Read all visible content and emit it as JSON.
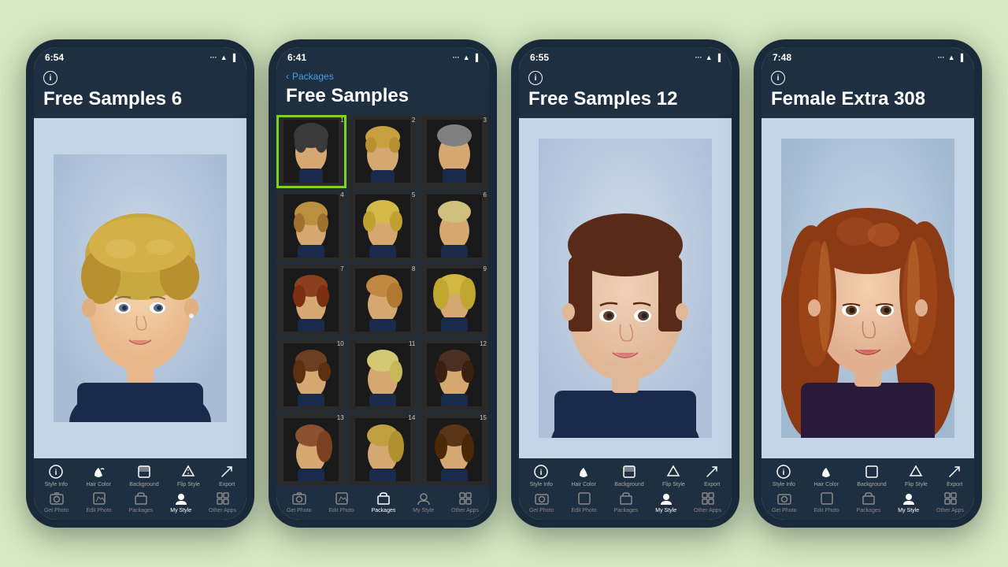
{
  "phones": [
    {
      "id": "phone1",
      "status": {
        "time": "6:54",
        "signal": "···",
        "wifi": "wifi",
        "battery": "battery"
      },
      "header": {
        "show_back": false,
        "back_label": "",
        "back_packages": "",
        "info_icon": "i",
        "title": "Free Samples 6"
      },
      "content_type": "single_photo",
      "toolbar": {
        "top_items": [
          {
            "icon": "ℹ",
            "label": "Style Info"
          },
          {
            "icon": "🪣",
            "label": "Hair Color"
          },
          {
            "icon": "🖼",
            "label": "Background"
          },
          {
            "icon": "⛵",
            "label": "Flip Style"
          },
          {
            "icon": "↗",
            "label": "Export"
          }
        ],
        "bottom_items": [
          {
            "icon": "📷",
            "label": "Get Photo"
          },
          {
            "icon": "✂",
            "label": "Edit Photo"
          },
          {
            "icon": "📦",
            "label": "Packages"
          },
          {
            "icon": "👤",
            "label": "My Style",
            "active": true
          },
          {
            "icon": "⬛",
            "label": "Other Apps"
          }
        ]
      }
    },
    {
      "id": "phone2",
      "status": {
        "time": "6:41",
        "signal": "···",
        "wifi": "wifi",
        "battery": "battery"
      },
      "header": {
        "show_back": true,
        "back_label": "Packages",
        "info_icon": "",
        "title": "Free Samples"
      },
      "content_type": "grid",
      "grid_items": [
        {
          "number": 1,
          "selected": true
        },
        {
          "number": 2,
          "selected": false
        },
        {
          "number": 3,
          "selected": false
        },
        {
          "number": 4,
          "selected": false
        },
        {
          "number": 5,
          "selected": false
        },
        {
          "number": 6,
          "selected": false
        },
        {
          "number": 7,
          "selected": false
        },
        {
          "number": 8,
          "selected": false
        },
        {
          "number": 9,
          "selected": false
        },
        {
          "number": 10,
          "selected": false
        },
        {
          "number": 11,
          "selected": false
        },
        {
          "number": 12,
          "selected": false
        },
        {
          "number": 13,
          "selected": false
        },
        {
          "number": 14,
          "selected": false
        },
        {
          "number": 15,
          "selected": false
        }
      ],
      "toolbar": {
        "top_items": [],
        "bottom_items": [
          {
            "icon": "📷",
            "label": "Get Photo"
          },
          {
            "icon": "✂",
            "label": "Edit Photo"
          },
          {
            "icon": "📦",
            "label": "Packages",
            "active": true
          },
          {
            "icon": "👤",
            "label": "My Style"
          },
          {
            "icon": "⬛",
            "label": "Other Apps"
          }
        ]
      }
    },
    {
      "id": "phone3",
      "status": {
        "time": "6:55",
        "signal": "···",
        "wifi": "wifi",
        "battery": "battery"
      },
      "header": {
        "show_back": false,
        "back_label": "",
        "back_packages": "",
        "info_icon": "i",
        "title": "Free Samples 12"
      },
      "content_type": "single_photo",
      "toolbar": {
        "top_items": [
          {
            "icon": "ℹ",
            "label": "Style Info"
          },
          {
            "icon": "🪣",
            "label": "Hair Color"
          },
          {
            "icon": "🖼",
            "label": "Background"
          },
          {
            "icon": "⛵",
            "label": "Flip Style"
          },
          {
            "icon": "↗",
            "label": "Export"
          }
        ],
        "bottom_items": [
          {
            "icon": "📷",
            "label": "Get Photo"
          },
          {
            "icon": "✂",
            "label": "Edit Photo"
          },
          {
            "icon": "📦",
            "label": "Packages"
          },
          {
            "icon": "👤",
            "label": "My Style",
            "active": true
          },
          {
            "icon": "⬛",
            "label": "Other Apps"
          }
        ]
      }
    },
    {
      "id": "phone4",
      "status": {
        "time": "7:48",
        "signal": "···",
        "wifi": "wifi",
        "battery": "battery"
      },
      "header": {
        "show_back": false,
        "back_label": "",
        "back_packages": "",
        "info_icon": "i",
        "title": "Female Extra 308"
      },
      "content_type": "single_photo",
      "toolbar": {
        "top_items": [
          {
            "icon": "ℹ",
            "label": "Style Info"
          },
          {
            "icon": "🪣",
            "label": "Hair Color"
          },
          {
            "icon": "🖼",
            "label": "Background"
          },
          {
            "icon": "⛵",
            "label": "Flip Style"
          },
          {
            "icon": "↗",
            "label": "Export"
          }
        ],
        "bottom_items": [
          {
            "icon": "📷",
            "label": "Get Photo"
          },
          {
            "icon": "✂",
            "label": "Edit Photo"
          },
          {
            "icon": "📦",
            "label": "Packages"
          },
          {
            "icon": "👤",
            "label": "My Style",
            "active": true
          },
          {
            "icon": "⬛",
            "label": "Other Apps"
          }
        ]
      }
    }
  ]
}
